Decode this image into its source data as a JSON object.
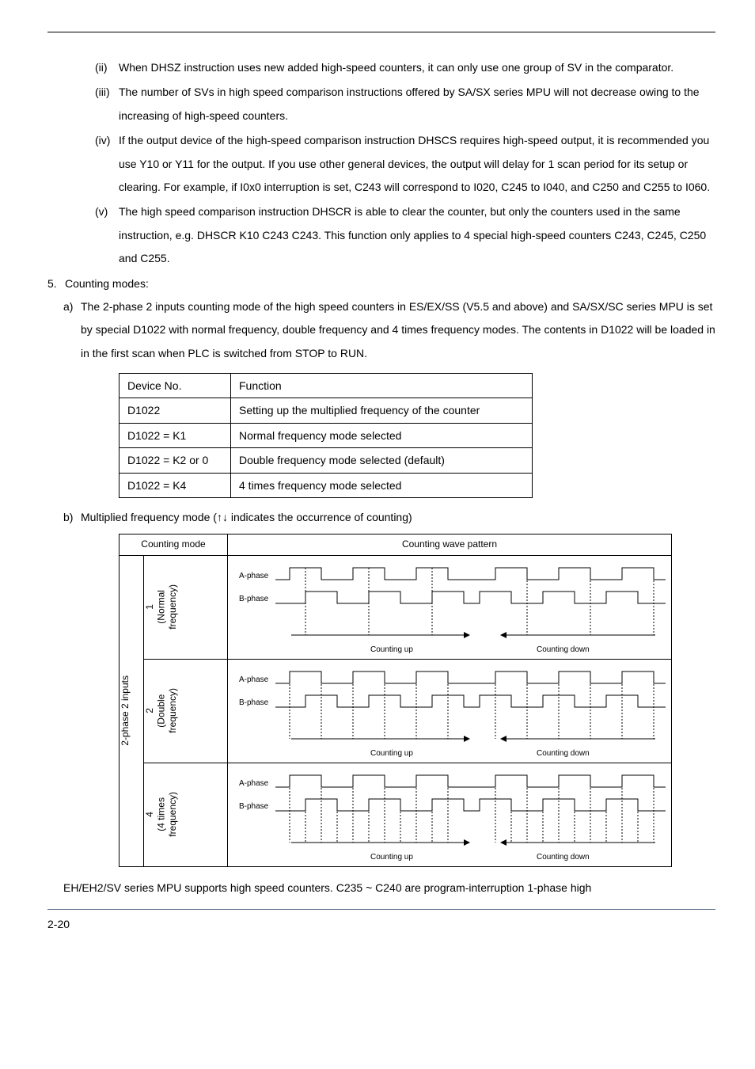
{
  "outline": {
    "ii": {
      "marker": "(ii)",
      "text": "When DHSZ instruction uses new added high-speed counters, it can only use one group of SV in the comparator."
    },
    "iii": {
      "marker": "(iii)",
      "text": "The number of SVs in high speed comparison instructions offered by SA/SX series MPU will not decrease owing to the increasing of high-speed counters."
    },
    "iv": {
      "marker": "(iv)",
      "text": "If the output device of the high-speed comparison instruction DHSCS requires high-speed output, it is recommended you use Y10 or Y11 for the output. If you use other general devices, the output will delay for 1 scan period for its setup or clearing. For example, if I0x0 interruption is set, C243 will correspond to I020, C245 to I040, and C250 and C255 to I060."
    },
    "v": {
      "marker": "(v)",
      "text": "The high speed comparison instruction DHSCR is able to clear the counter, but only the counters used in the same instruction, e.g. DHSCR K10 C243 C243. This function only applies to 4 special high-speed counters C243, C245, C250 and C255."
    }
  },
  "five": {
    "marker": "5.",
    "text": "Counting modes:"
  },
  "five_a": {
    "marker": "a)",
    "text": "The 2-phase 2 inputs counting mode of the high speed counters in ES/EX/SS (V5.5 and above) and SA/SX/SC series MPU is set by special D1022 with normal frequency, double frequency and 4 times frequency modes. The contents in D1022 will be loaded in in the first scan when PLC is switched from STOP to RUN."
  },
  "table1": {
    "rows": [
      {
        "c1": "Device No.",
        "c2": "Function"
      },
      {
        "c1": "D1022",
        "c2": "Setting up the multiplied frequency of the counter"
      },
      {
        "c1": "D1022 = K1",
        "c2": "Normal frequency mode selected"
      },
      {
        "c1": "D1022 = K2 or 0",
        "c2": "Double frequency mode selected (default)"
      },
      {
        "c1": "D1022 = K4",
        "c2": "4 times frequency mode selected"
      }
    ]
  },
  "five_b": {
    "marker": "b)",
    "text": "Multiplied frequency mode (↑↓ indicates the occurrence of counting)"
  },
  "table2": {
    "hdr_mode": "Counting mode",
    "hdr_wave": "Counting wave pattern",
    "side": "2-phase 2 inputs",
    "modes": {
      "m1a": "1",
      "m1b": "(Normal",
      "m1c": "frequency)",
      "m2a": "2",
      "m2b": "(Double",
      "m2c": "frequency)",
      "m3a": "4",
      "m3b": "(4 times",
      "m3c": "frequency)"
    },
    "wave": {
      "a": "A-phase",
      "b": "B-phase",
      "up": "Counting up",
      "down": "Counting down"
    }
  },
  "footer_para": "EH/EH2/SV series MPU supports high speed counters. C235 ~ C240 are program-interruption 1-phase high",
  "page": "2-20"
}
